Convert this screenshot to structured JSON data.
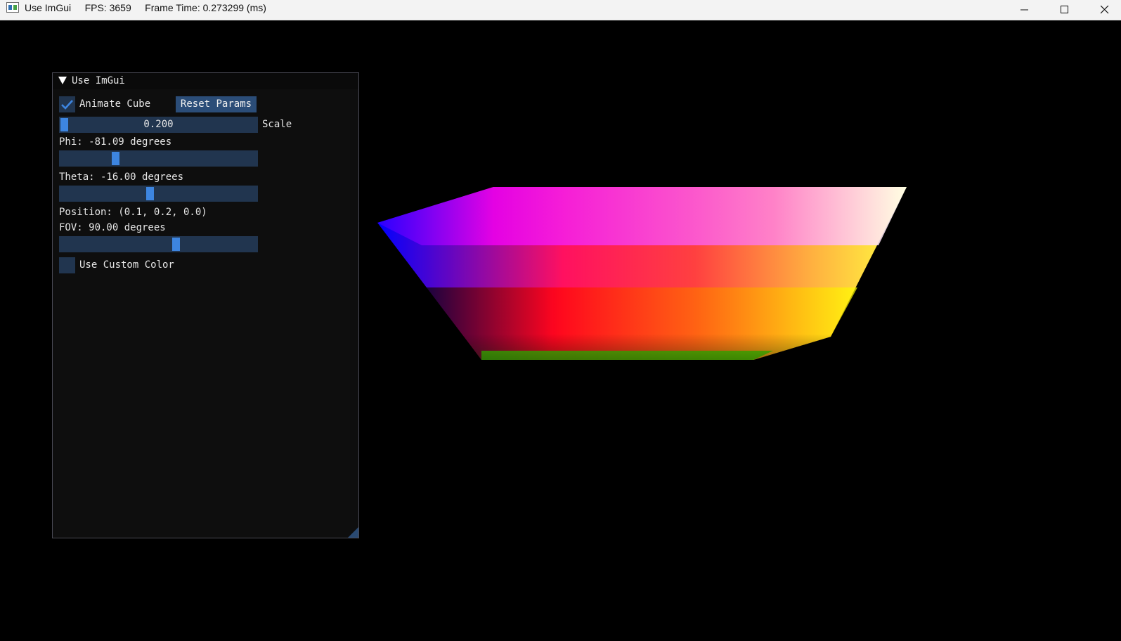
{
  "os_window": {
    "title": "Use ImGui     FPS: 3659     Frame Time: 0.273299 (ms)",
    "icon": "app-window-icon",
    "controls": [
      "minimize-icon",
      "maximize-icon",
      "close-icon"
    ]
  },
  "imgui": {
    "window_title": "Use ImGui",
    "animate_cube": {
      "label": "Animate Cube",
      "checked": true
    },
    "reset_button": "Reset Params",
    "scale": {
      "value": "0.200",
      "label": "Scale",
      "fraction": 0.0
    },
    "phi": {
      "text": "Phi: -81.09 degrees",
      "fraction": 0.274
    },
    "theta": {
      "text": "Theta: -16.00 degrees",
      "fraction": 0.456
    },
    "position": "Position: (0.1, 0.2, 0.0)",
    "fov": {
      "text": "FOV: 90.00 degrees",
      "fraction": 0.592
    },
    "use_custom_color": {
      "label": "Use Custom Color",
      "checked": false
    }
  },
  "colors": {
    "accent": "#3d85e0",
    "frame_bg": "#21354f",
    "button_bg": "#2b4d78",
    "window_bg": "#0f0f0f"
  }
}
